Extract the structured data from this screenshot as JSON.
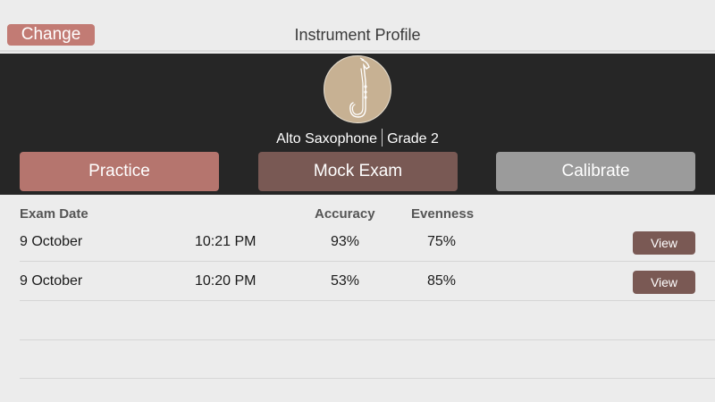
{
  "navbar": {
    "change_label": "Change",
    "title": "Instrument Profile"
  },
  "profile": {
    "instrument": "Alto Saxophone",
    "grade": "Grade 2",
    "avatar_icon": "saxophone-icon"
  },
  "actions": {
    "practice_label": "Practice",
    "mock_exam_label": "Mock Exam",
    "calibrate_label": "Calibrate"
  },
  "table": {
    "headers": {
      "exam_date": "Exam Date",
      "accuracy": "Accuracy",
      "evenness": "Evenness"
    },
    "rows": [
      {
        "date": "9 October",
        "time": "10:21 PM",
        "accuracy": "93%",
        "evenness": "75%",
        "action": "View"
      },
      {
        "date": "9 October",
        "time": "10:20 PM",
        "accuracy": "53%",
        "evenness": "85%",
        "action": "View"
      }
    ]
  },
  "colors": {
    "accent_rose": "#c27b74",
    "accent_brown": "#795954",
    "neutral_gray": "#9b9b9b",
    "header_dark": "#262626"
  }
}
